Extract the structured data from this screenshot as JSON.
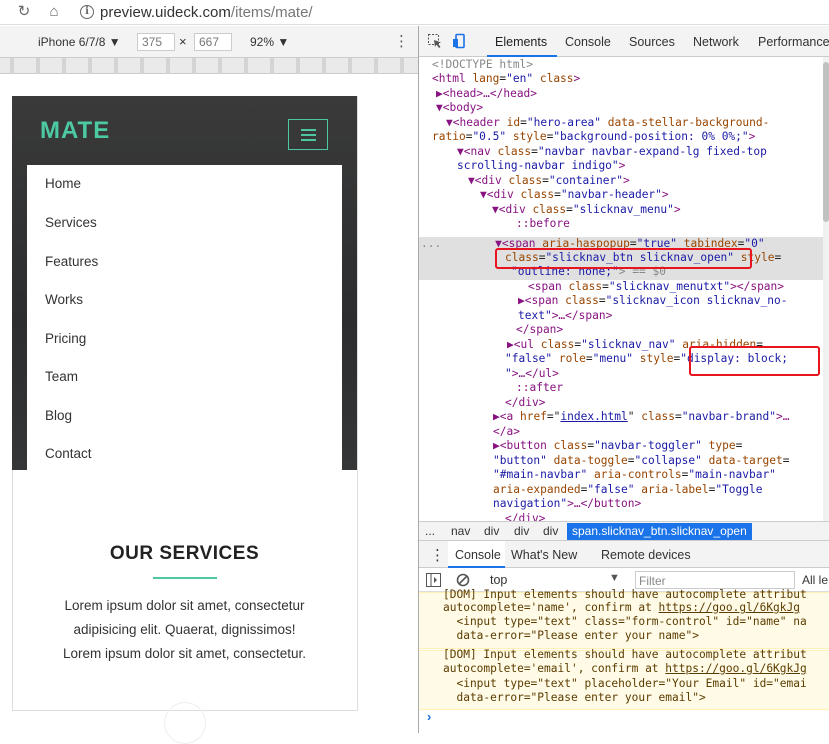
{
  "browser": {
    "url_host": "preview.uideck.com",
    "url_path": "/items/mate/"
  },
  "emulation": {
    "device": "iPhone 6/7/8 ▼",
    "width": "375",
    "times": "×",
    "height": "667",
    "zoom": "92% ▼"
  },
  "site": {
    "logo": "MATE",
    "menu": [
      "Home",
      "Services",
      "Features",
      "Works",
      "Pricing",
      "Team",
      "Blog",
      "Contact"
    ],
    "services_title": "OUR SERVICES",
    "services_text": [
      "Lorem ipsum dolor sit amet, consectetur",
      "adipisicing elit. Quaerat, dignissimos!",
      "Lorem ipsum dolor sit amet, consectetur."
    ]
  },
  "devtools": {
    "tabs": [
      "Elements",
      "Console",
      "Sources",
      "Network",
      "Performance"
    ],
    "active_tab": "Elements",
    "colors": {
      "accent": "#1a73e8",
      "highlight": "#e8141e",
      "brand": "#4cc9a3"
    },
    "dom": {
      "l1": "<!DOCTYPE html>",
      "l2_tag": "<html",
      "l2_a1": "lang",
      "l2_v1": "\"en\"",
      "l2_a2": "class",
      "l2_end": ">",
      "l3": "▶<head>…</head>",
      "l4": "▼<body>",
      "l5_t": "▼<header",
      "l5_a1": "id",
      "l5_v1": "\"hero-area\"",
      "l5_a2": "data-stellar-background-",
      "l6_a": "ratio",
      "l6_v": "\"0.5\"",
      "l6_a2": "style",
      "l6_v2": "\"background-position: 0% 0%;\"",
      "l6_e": ">",
      "l7_t": "▼<nav",
      "l7_a": "class",
      "l7_v": "\"navbar navbar-expand-lg fixed-top",
      "l8_v": "scrolling-navbar indigo\"",
      "l8_e": ">",
      "l9_t": "▼<div",
      "l9_a": "class",
      "l9_v": "\"container\"",
      "l9_e": ">",
      "l10_t": "▼<div",
      "l10_a": "class",
      "l10_v": "\"navbar-header\"",
      "l10_e": ">",
      "l11_t": "▼<div",
      "l11_a": "class",
      "l11_v": "\"slicknav_menu\"",
      "l11_e": ">",
      "l12": "::before",
      "l13_dots": "...",
      "l13_t": "▼<span",
      "l13_a1": "aria-haspopup",
      "l13_v1": "\"true\"",
      "l13_a2": "tabindex",
      "l13_v2": "\"0\"",
      "l14_a": "class",
      "l14_v": "\"slicknav_btn slicknav_open\"",
      "l14_a2": "style",
      "l15_v": "\"outline: none;\"",
      "l15_e": "> == $0",
      "l16_t": "<span",
      "l16_a": "class",
      "l16_v": "\"slicknav_menutxt\"",
      "l16_e": "></span>",
      "l17_t": "▶<span",
      "l17_a": "class",
      "l17_v": "\"slicknav_icon slicknav_no-",
      "l18_v": "text\"",
      "l18_e": ">…</span>",
      "l19": "</span>",
      "l20_t": "▶<ul",
      "l20_a": "class",
      "l20_v": "\"slicknav_nav\"",
      "l20_a2": "aria-hidden",
      "l21_v": "\"false\"",
      "l21_a": "role",
      "l21_v2": "\"menu\"",
      "l21_a3": "style",
      "l21_v3": "\"display: block;",
      "l22_v": "\"",
      "l22_e": ">…</ul>",
      "l23": "::after",
      "l24": "</div>",
      "l25_t": "▶<a",
      "l25_a": "href",
      "l25_v": "index.html",
      "l25_a2": "class",
      "l25_v2": "\"navbar-brand\"",
      "l25_e": ">…",
      "l26": "</a>",
      "l27_t": "▶<button",
      "l27_a": "class",
      "l27_v": "\"navbar-toggler\"",
      "l27_a2": "type",
      "l28_v": "\"button\"",
      "l28_a": "data-toggle",
      "l28_v2": "\"collapse\"",
      "l28_a2": "data-target",
      "l29_v": "\"#main-navbar\"",
      "l29_a": "aria-controls",
      "l29_v2": "\"main-navbar\"",
      "l30_a": "aria-expanded",
      "l30_v": "\"false\"",
      "l30_a2": "aria-label",
      "l30_v2": "\"Toggle",
      "l31_v": "navigation\"",
      "l31_e": ">…</button>",
      "l32": "</div>"
    },
    "breadcrumbs": [
      "...",
      "nav",
      "div",
      "div",
      "div",
      "span.slicknav_btn.slicknav_open"
    ],
    "drawer_tabs": [
      "Console",
      "What's New",
      "Remote devices"
    ],
    "console_context": "top",
    "filter_placeholder": "Filter",
    "levels": "All le",
    "messages": {
      "m1_l1": "[DOM] Input elements should have autocomplete attribut",
      "m1_l2a": "autocomplete='name', confirm at ",
      "m1_l2b": "https://goo.gl/6KgkJg",
      "m1_l3": "  <input type=\"text\" class=\"form-control\" id=\"name\" na",
      "m1_l4": "  data-error=\"Please enter your name\">",
      "m2_l1": "[DOM] Input elements should have autocomplete attribut",
      "m2_l2a": "autocomplete='email', confirm at ",
      "m2_l2b": "https://goo.gl/6KgkJg",
      "m2_l3": "  <input type=\"text\" placeholder=\"Your Email\" id=\"emai",
      "m2_l4": "  data-error=\"Please enter your email\">"
    },
    "prompt": "›"
  }
}
